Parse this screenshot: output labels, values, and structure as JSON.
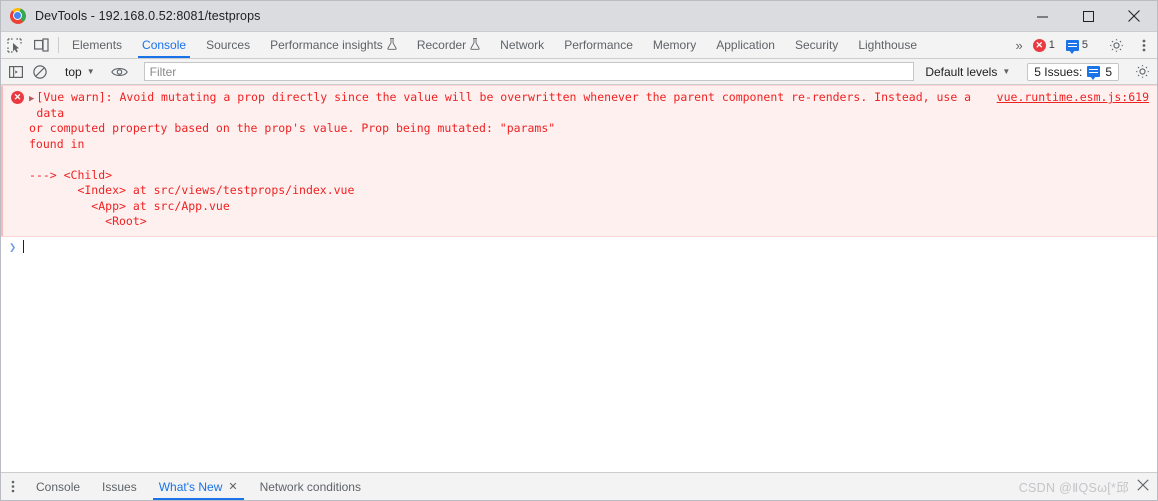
{
  "window": {
    "title": "DevTools - 192.168.0.52:8081/testprops",
    "logo_icon": "chrome-logo-icon",
    "controls": {
      "minimize": "minimize-icon",
      "maximize": "maximize-icon",
      "close": "close-icon"
    }
  },
  "toolbar": {
    "inspect_icon": "inspect-element-icon",
    "device_icon": "device-toolbar-icon",
    "tabs": [
      {
        "label": "Elements",
        "active": false,
        "icon": ""
      },
      {
        "label": "Console",
        "active": true,
        "icon": ""
      },
      {
        "label": "Sources",
        "active": false,
        "icon": ""
      },
      {
        "label": "Performance insights",
        "active": false,
        "icon": "flask-icon"
      },
      {
        "label": "Recorder",
        "active": false,
        "icon": "flask-icon"
      },
      {
        "label": "Network",
        "active": false,
        "icon": ""
      },
      {
        "label": "Performance",
        "active": false,
        "icon": ""
      },
      {
        "label": "Memory",
        "active": false,
        "icon": ""
      },
      {
        "label": "Application",
        "active": false,
        "icon": ""
      },
      {
        "label": "Security",
        "active": false,
        "icon": ""
      },
      {
        "label": "Lighthouse",
        "active": false,
        "icon": ""
      }
    ],
    "overflow_label": "»",
    "error_count": "1",
    "message_count": "5",
    "settings_icon": "gear-icon",
    "more_icon": "kebab-menu-icon",
    "colors": {
      "accent": "#1a73e8",
      "error": "#eb3941",
      "tab_inactive": "#5f6368"
    }
  },
  "filterbar": {
    "sidebar_toggle_icon": "console-sidebar-icon",
    "clear_console_icon": "clear-console-icon",
    "context": "top",
    "context_caret": "▼",
    "eye_icon": "live-expression-eye-icon",
    "filter_placeholder": "Filter",
    "filter_value": "",
    "levels_label": "Default levels",
    "levels_caret": "▼",
    "issues_label": "5 Issues:",
    "issues_count": "5",
    "settings_icon": "console-settings-gear-icon"
  },
  "console": {
    "message": {
      "level": "error",
      "error_icon": "error-circle-icon",
      "expander_icon": "expand-triangle-icon",
      "line1": "[Vue warn]: Avoid mutating a prop directly since the value will be overwritten whenever the parent component re-renders. Instead, use a data",
      "line2": "or computed property based on the prop's value. Prop being mutated: \"params\"",
      "stack": "found in\n\n---> <Child>\n       <Index> at src/views/testprops/index.vue\n         <App> at src/App.vue\n           <Root>",
      "source_link": "vue.runtime.esm.js:619",
      "bg_color": "#fff0f0",
      "text_color": "#ef2222"
    },
    "prompt": {
      "chevron": "❯",
      "input_value": ""
    }
  },
  "drawer": {
    "menu_icon": "drawer-kebab-icon",
    "tabs": [
      {
        "label": "Console",
        "active": false,
        "closable": false
      },
      {
        "label": "Issues",
        "active": false,
        "closable": false
      },
      {
        "label": "What's New",
        "active": true,
        "closable": true
      },
      {
        "label": "Network conditions",
        "active": false,
        "closable": false
      }
    ],
    "close_label": "✕",
    "watermark": "CSDN @ⅡQSω[*邱",
    "drawer_close_icon": "drawer-close-icon"
  }
}
